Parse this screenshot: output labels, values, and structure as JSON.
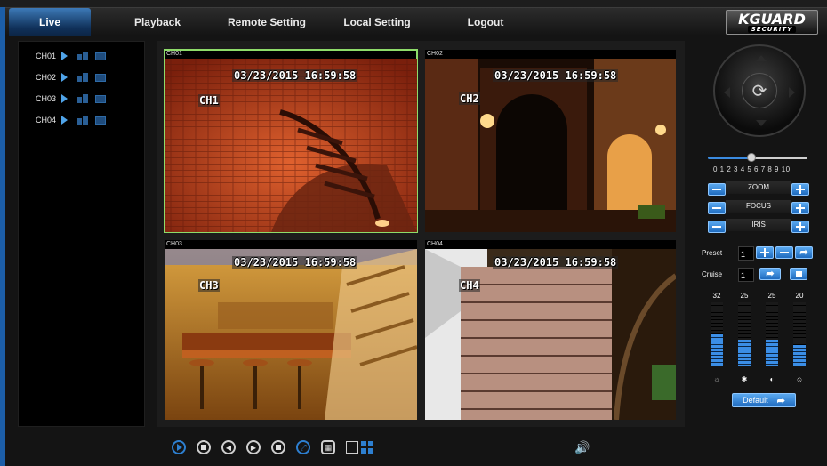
{
  "nav": {
    "items": [
      {
        "label": "Live",
        "active": true
      },
      {
        "label": "Playback"
      },
      {
        "label": "Remote Setting"
      },
      {
        "label": "Local Setting"
      },
      {
        "label": "Logout"
      }
    ],
    "logo_main": "KGUARD",
    "logo_sub": "SECURITY"
  },
  "channels": [
    {
      "label": "CH01"
    },
    {
      "label": "CH02"
    },
    {
      "label": "CH03"
    },
    {
      "label": "CH04"
    }
  ],
  "tiles": [
    {
      "label": "CH01",
      "timestamp": "03/23/2015 16:59:58",
      "osd_name": "CH1",
      "selected": true
    },
    {
      "label": "CH02",
      "timestamp": "03/23/2015 16:59:58",
      "osd_name": "CH2"
    },
    {
      "label": "CH03",
      "timestamp": "03/23/2015 16:59:58",
      "osd_name": "CH3"
    },
    {
      "label": "CH04",
      "timestamp": "03/23/2015 16:59:58",
      "osd_name": "CH4"
    }
  ],
  "ptz": {
    "speed_scale": "0 1 2 3 4 5 6 7 8 9 10",
    "speed_value": 4,
    "zoom_label": "ZOOM",
    "focus_label": "FOCUS",
    "iris_label": "IRIS",
    "preset_label": "Preset",
    "preset_value": "1",
    "cruise_label": "Cruise",
    "cruise_value": "1",
    "default_label": "Default"
  },
  "image_settings": [
    {
      "value": "32",
      "icon": "brightness-icon"
    },
    {
      "value": "25",
      "icon": "contrast-icon"
    },
    {
      "value": "25",
      "icon": "saturation-icon"
    },
    {
      "value": "20",
      "icon": "hue-icon"
    }
  ],
  "colors": {
    "accent": "#2d7fd0",
    "selected_tile_border": "#8edc6a",
    "frame_border": "#1c5ea8"
  }
}
